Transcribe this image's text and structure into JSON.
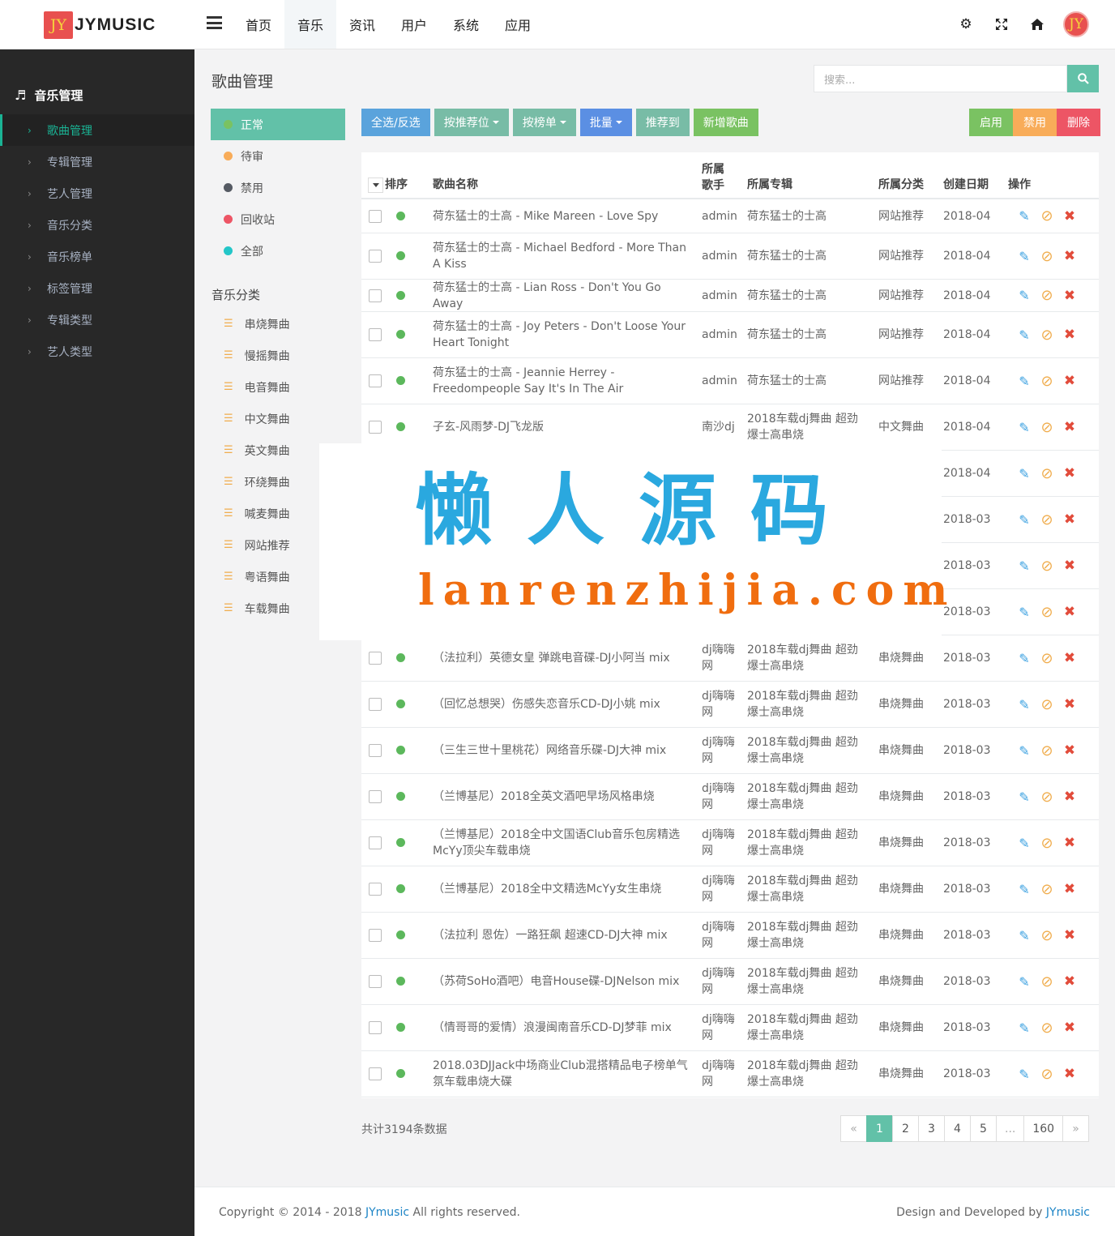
{
  "brand": {
    "badge": "JY",
    "name": "JYMUSIC"
  },
  "nav": [
    "首页",
    "音乐",
    "资讯",
    "用户",
    "系统",
    "应用"
  ],
  "nav_active": 1,
  "top_icons": [
    "gear-icon",
    "fullscreen-icon",
    "home-icon"
  ],
  "avatar": "JY",
  "sidebar": {
    "section": "音乐管理",
    "items": [
      "歌曲管理",
      "专辑管理",
      "艺人管理",
      "音乐分类",
      "音乐榜单",
      "标签管理",
      "专辑类型",
      "艺人类型"
    ]
  },
  "page_title": "歌曲管理",
  "search": {
    "placeholder": "搜索..."
  },
  "status_filters": [
    {
      "label": "正常",
      "color": "#7ac262"
    },
    {
      "label": "待审",
      "color": "#f8ac59"
    },
    {
      "label": "禁用",
      "color": "#555a63"
    },
    {
      "label": "回收站",
      "color": "#ed5565"
    },
    {
      "label": "全部",
      "color": "#23c6c8"
    }
  ],
  "category_title": "音乐分类",
  "categories": [
    "串烧舞曲",
    "慢摇舞曲",
    "电音舞曲",
    "中文舞曲",
    "英文舞曲",
    "环绕舞曲",
    "喊麦舞曲",
    "网站推荐",
    "粤语舞曲",
    "车载舞曲"
  ],
  "toolbar": {
    "select_all": "全选/反选",
    "by_position": "按推荐位",
    "by_chart": "按榜单",
    "batch": "批量",
    "recommend_to": "推荐到",
    "add_song": "新增歌曲",
    "enable": "启用",
    "disable": "禁用",
    "delete": "删除"
  },
  "table": {
    "headers": {
      "sort": "排序",
      "name": "歌曲名称",
      "artist": "所属歌手",
      "album": "所属专辑",
      "category": "所属分类",
      "date": "创建日期",
      "ops": "操作"
    },
    "rows": [
      {
        "name": "荷东猛士的士高 - Mike Mareen - Love Spy",
        "artist": "admin",
        "album": "荷东猛士的士高",
        "category": "网站推荐",
        "date": "2018-04"
      },
      {
        "name": "荷东猛士的士高 - Michael Bedford - More Than A Kiss",
        "artist": "admin",
        "album": "荷东猛士的士高",
        "category": "网站推荐",
        "date": "2018-04"
      },
      {
        "name": "荷东猛士的士高 - Lian Ross - Don't You Go Away",
        "artist": "admin",
        "album": "荷东猛士的士高",
        "category": "网站推荐",
        "date": "2018-04"
      },
      {
        "name": "荷东猛士的士高 - Joy Peters - Don't Loose Your Heart Tonight",
        "artist": "admin",
        "album": "荷东猛士的士高",
        "category": "网站推荐",
        "date": "2018-04"
      },
      {
        "name": "荷东猛士的士高 - Jeannie Herrey - Freedompeople Say It's In The Air",
        "artist": "admin",
        "album": "荷东猛士的士高",
        "category": "网站推荐",
        "date": "2018-04"
      },
      {
        "name": "子玄-风雨梦-DJ飞龙版",
        "artist": "南沙dj",
        "album": "2018车载dj舞曲 超劲爆士高串烧",
        "category": "中文舞曲",
        "date": "2018-04"
      },
      {
        "name": "",
        "artist": "",
        "album": "",
        "category": "",
        "date": "2018-04"
      },
      {
        "name": "",
        "artist": "",
        "album": "",
        "category": "",
        "date": "2018-03"
      },
      {
        "name": "",
        "artist": "",
        "album": "",
        "category": "",
        "date": "2018-03"
      },
      {
        "name": "",
        "artist": "",
        "album": "",
        "category": "",
        "date": "2018-03"
      },
      {
        "name": "（法拉利）英德女皇 弹跳电音碟-DJ小阿当 mix",
        "artist": "dj嗨嗨网",
        "album": "2018车载dj舞曲 超劲爆士高串烧",
        "category": "串烧舞曲",
        "date": "2018-03"
      },
      {
        "name": "（回忆总想哭）伤感失恋音乐CD-DJ小姚 mix",
        "artist": "dj嗨嗨网",
        "album": "2018车载dj舞曲 超劲爆士高串烧",
        "category": "串烧舞曲",
        "date": "2018-03"
      },
      {
        "name": "（三生三世十里桃花）网络音乐碟-DJ大神 mix",
        "artist": "dj嗨嗨网",
        "album": "2018车载dj舞曲 超劲爆士高串烧",
        "category": "串烧舞曲",
        "date": "2018-03"
      },
      {
        "name": "（兰博基尼）2018全英文酒吧早场风格串烧",
        "artist": "dj嗨嗨网",
        "album": "2018车载dj舞曲 超劲爆士高串烧",
        "category": "串烧舞曲",
        "date": "2018-03"
      },
      {
        "name": "（兰博基尼）2018全中文国语Club音乐包房精选McYy顶尖车载串烧",
        "artist": "dj嗨嗨网",
        "album": "2018车载dj舞曲 超劲爆士高串烧",
        "category": "串烧舞曲",
        "date": "2018-03"
      },
      {
        "name": "（兰博基尼）2018全中文精选McYy女生串烧",
        "artist": "dj嗨嗨网",
        "album": "2018车载dj舞曲 超劲爆士高串烧",
        "category": "串烧舞曲",
        "date": "2018-03"
      },
      {
        "name": "（法拉利 恩佐）一路狂飙 超速CD-DJ大神 mix",
        "artist": "dj嗨嗨网",
        "album": "2018车载dj舞曲 超劲爆士高串烧",
        "category": "串烧舞曲",
        "date": "2018-03"
      },
      {
        "name": "（苏荷SoHo酒吧）电音House碟-DJNelson mix",
        "artist": "dj嗨嗨网",
        "album": "2018车载dj舞曲 超劲爆士高串烧",
        "category": "串烧舞曲",
        "date": "2018-03"
      },
      {
        "name": "（情哥哥的爱情）浪漫闽南音乐CD-DJ梦菲 mix",
        "artist": "dj嗨嗨网",
        "album": "2018车载dj舞曲 超劲爆士高串烧",
        "category": "串烧舞曲",
        "date": "2018-03"
      },
      {
        "name": "2018.03DJJack中场商业Club混搭精品电子榜单气氛车载串烧大碟",
        "artist": "dj嗨嗨网",
        "album": "2018车载dj舞曲 超劲爆士高串烧",
        "category": "串烧舞曲",
        "date": "2018-03"
      }
    ],
    "row_icons": [
      "pencil-icon",
      "ban-icon",
      "times-icon"
    ]
  },
  "total_text": "共计3194条数据",
  "pagination": [
    "«",
    "1",
    "2",
    "3",
    "4",
    "5",
    "...",
    "160",
    "»"
  ],
  "pagination_active": 1,
  "footer": {
    "left_prefix": "Copyright © 2014 - 2018 ",
    "left_brand": "JYmusic",
    "left_suffix": " All rights reserved.",
    "right_prefix": "Design and Developed by ",
    "right_brand": "JYmusic"
  },
  "watermark": {
    "cn": "懒人源码",
    "en": "lanrenzhijia.com"
  },
  "colors": {
    "accent": "#1ab394",
    "teal_button": "#62c1a8",
    "sidebar_bg": "#282828",
    "enable": "#7ac262",
    "disable": "#f8ac59",
    "delete": "#ed5565"
  }
}
